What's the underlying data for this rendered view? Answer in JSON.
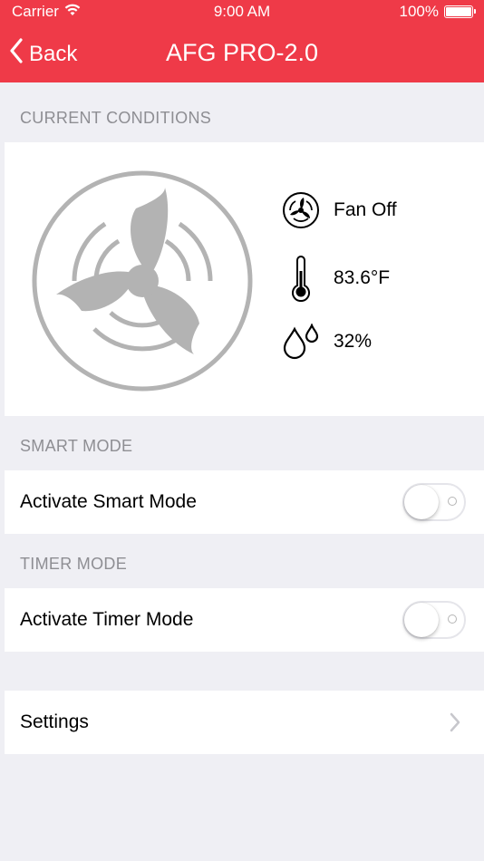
{
  "status_bar": {
    "carrier": "Carrier",
    "time": "9:00 AM",
    "battery": "100%"
  },
  "nav": {
    "back_label": "Back",
    "title": "AFG PRO-2.0"
  },
  "current_conditions": {
    "header": "CURRENT CONDITIONS",
    "fan_status": "Fan Off",
    "temperature": "83.6°F",
    "humidity": "32%"
  },
  "smart_mode": {
    "header": "SMART MODE",
    "label": "Activate Smart Mode",
    "enabled": false
  },
  "timer_mode": {
    "header": "TIMER MODE",
    "label": "Activate Timer Mode",
    "enabled": false
  },
  "settings": {
    "label": "Settings"
  },
  "colors": {
    "accent": "#ef3a48",
    "background": "#efeff4",
    "icon_gray": "#b3b3b3"
  }
}
